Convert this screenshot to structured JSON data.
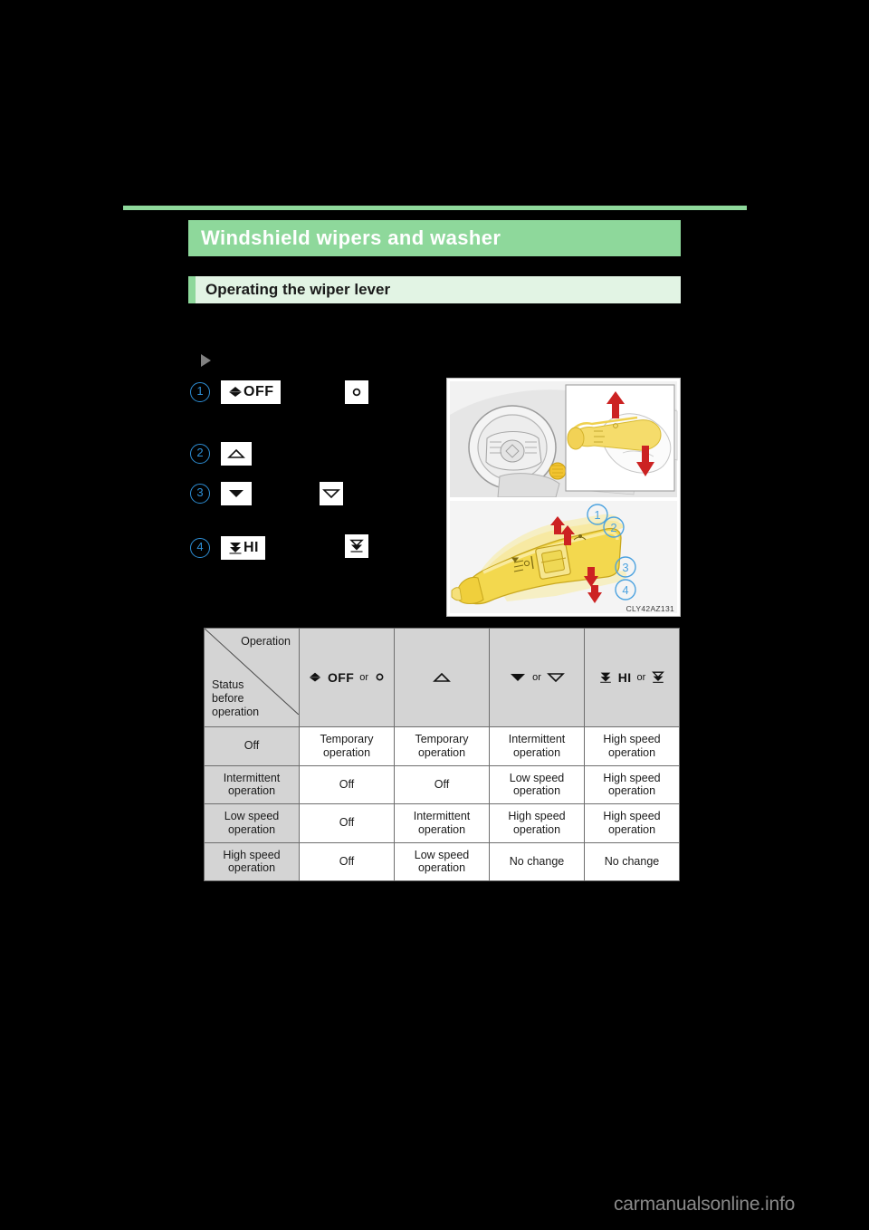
{
  "page": {
    "background_color": "#000000",
    "accent_green": "#8ed89b",
    "accent_green_light": "#e2f4e4",
    "circled_number_blue": "#2e8fd6"
  },
  "header": {
    "title": "Windshield wipers and washer",
    "subsection": "Operating the wiper lever"
  },
  "steps": {
    "bullet_marker": "triangle-right-bullet",
    "items": [
      {
        "number": "1",
        "primary_label": "OFF",
        "primary_icon": "wiper-off-icon",
        "alt_icon": "mist-dot-icon"
      },
      {
        "number": "2",
        "primary_label": "",
        "primary_icon": "triangle-up-outline-icon",
        "alt_icon": ""
      },
      {
        "number": "3",
        "primary_label": "",
        "primary_icon": "triangle-down-filled-icon",
        "alt_icon": "triangle-down-outline-icon"
      },
      {
        "number": "4",
        "primary_label": "HI",
        "primary_icon": "wiper-hi-icon",
        "alt_icon": "wiper-hi-double-chevron-icon"
      }
    ]
  },
  "illustration": {
    "caption": "CLY42AZ131",
    "callouts": [
      "1",
      "2",
      "3",
      "4"
    ],
    "description": "steering-column-wiper-lever-diagram"
  },
  "table": {
    "corner": {
      "column_axis_label": "Operation",
      "row_axis_label": "Status\nbefore\noperation",
      "row_axis_line1": "Status",
      "row_axis_line2": "before",
      "row_axis_line3": "operation"
    },
    "columns": [
      {
        "label": "OFF",
        "icon": "wiper-off-icon",
        "or_word": "or",
        "alt_icon": "mist-dot-icon"
      },
      {
        "label": "",
        "icon": "triangle-up-outline-icon",
        "or_word": "",
        "alt_icon": ""
      },
      {
        "label": "",
        "icon": "triangle-down-filled-icon",
        "or_word": "or",
        "alt_icon": "triangle-down-outline-icon"
      },
      {
        "label": "HI",
        "icon": "wiper-hi-icon",
        "or_word": "or",
        "alt_icon": "wiper-hi-double-chevron-icon"
      }
    ],
    "rows": [
      {
        "status": "Off",
        "cells": [
          "Temporary operation",
          "Temporary operation",
          "Intermittent operation",
          "High speed operation"
        ]
      },
      {
        "status": "Intermittent operation",
        "cells": [
          "Off",
          "Off",
          "Low speed operation",
          "High speed operation"
        ]
      },
      {
        "status": "Low speed operation",
        "cells": [
          "Off",
          "Intermittent operation",
          "High speed operation",
          "High speed operation"
        ]
      },
      {
        "status": "High speed operation",
        "cells": [
          "Off",
          "Low speed operation",
          "No change",
          "No change"
        ]
      }
    ]
  },
  "footer": {
    "watermark": "carmanualsonline.info"
  }
}
